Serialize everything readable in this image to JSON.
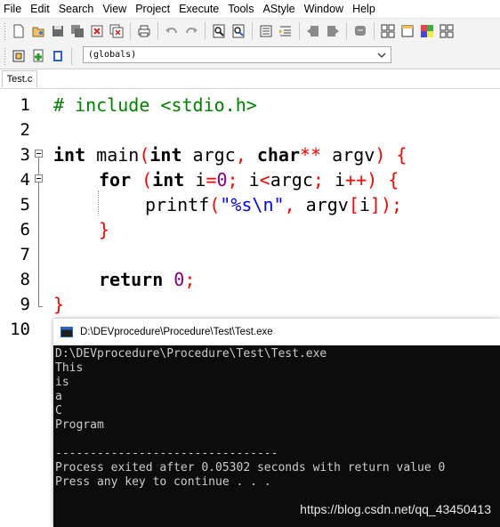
{
  "menu": [
    "File",
    "Edit",
    "Search",
    "View",
    "Project",
    "Execute",
    "Tools",
    "AStyle",
    "Window",
    "Help"
  ],
  "toolbar1_icons": [
    "new-file-icon",
    "open-file-icon",
    "save-icon",
    "save-all-icon",
    "close-file-icon",
    "close-all-icon",
    "print-icon",
    "undo-icon",
    "redo-icon",
    "find-icon",
    "replace-icon",
    "indent-icon",
    "unindent-icon",
    "bookmark-back-icon",
    "bookmark-forward-icon",
    "comment-icon",
    "layout-grid-icon",
    "panel-icon",
    "color-grid-icon",
    "grid-small-icon"
  ],
  "toolbar2_icons": [
    "project-icon",
    "add-file-icon",
    "class-browser-icon"
  ],
  "scope_select": {
    "value": "(globals)"
  },
  "tab": {
    "label": "Test.c"
  },
  "code_lines": [
    {
      "num": "1"
    },
    {
      "num": "2"
    },
    {
      "num": "3"
    },
    {
      "num": "4"
    },
    {
      "num": "5"
    },
    {
      "num": "6"
    },
    {
      "num": "7"
    },
    {
      "num": "8"
    },
    {
      "num": "9"
    },
    {
      "num": "10"
    }
  ],
  "code": {
    "l1_pp": "# include <stdio.h>",
    "l3_int": "int",
    "l3_main": " main",
    "l3_lp": "(",
    "l3_int2": "int",
    "l3_argc": " argc",
    "l3_comma": ",",
    "l3_char": " char",
    "l3_stars": "**",
    "l3_argv": " argv",
    "l3_rp": ")",
    "l3_brace": " {",
    "l4_for": "for",
    "l4_lp": " (",
    "l4_int": "int",
    "l4_i": " i",
    "l4_eq": "=",
    "l4_zero": "0",
    "l4_semi1": ";",
    "l4_i2": " i",
    "l4_lt": "<",
    "l4_argc": "argc",
    "l4_semi2": ";",
    "l4_i3": " i",
    "l4_pp": "++",
    "l4_rp": ")",
    "l4_brace": " {",
    "l5_printf": "printf",
    "l5_lp": "(",
    "l5_str": "\"%s\\n\"",
    "l5_comma": ",",
    "l5_argv": " argv",
    "l5_lb": "[",
    "l5_i": "i",
    "l5_rb": "]",
    "l5_rp": ")",
    "l5_semi": ";",
    "l6_brace": "}",
    "l8_return": "return",
    "l8_zero": " 0",
    "l8_semi": ";",
    "l9_brace": "}"
  },
  "console": {
    "title": "D:\\DEVprocedure\\Procedure\\Test\\Test.exe",
    "lines": [
      "D:\\DEVprocedure\\Procedure\\Test\\Test.exe",
      "This",
      "is",
      "a",
      "C",
      "Program",
      "",
      "--------------------------------",
      "Process exited after 0.05302 seconds with return value 0",
      "Press any key to continue . . ."
    ]
  },
  "watermark": "https://blog.csdn.net/qq_43450413"
}
